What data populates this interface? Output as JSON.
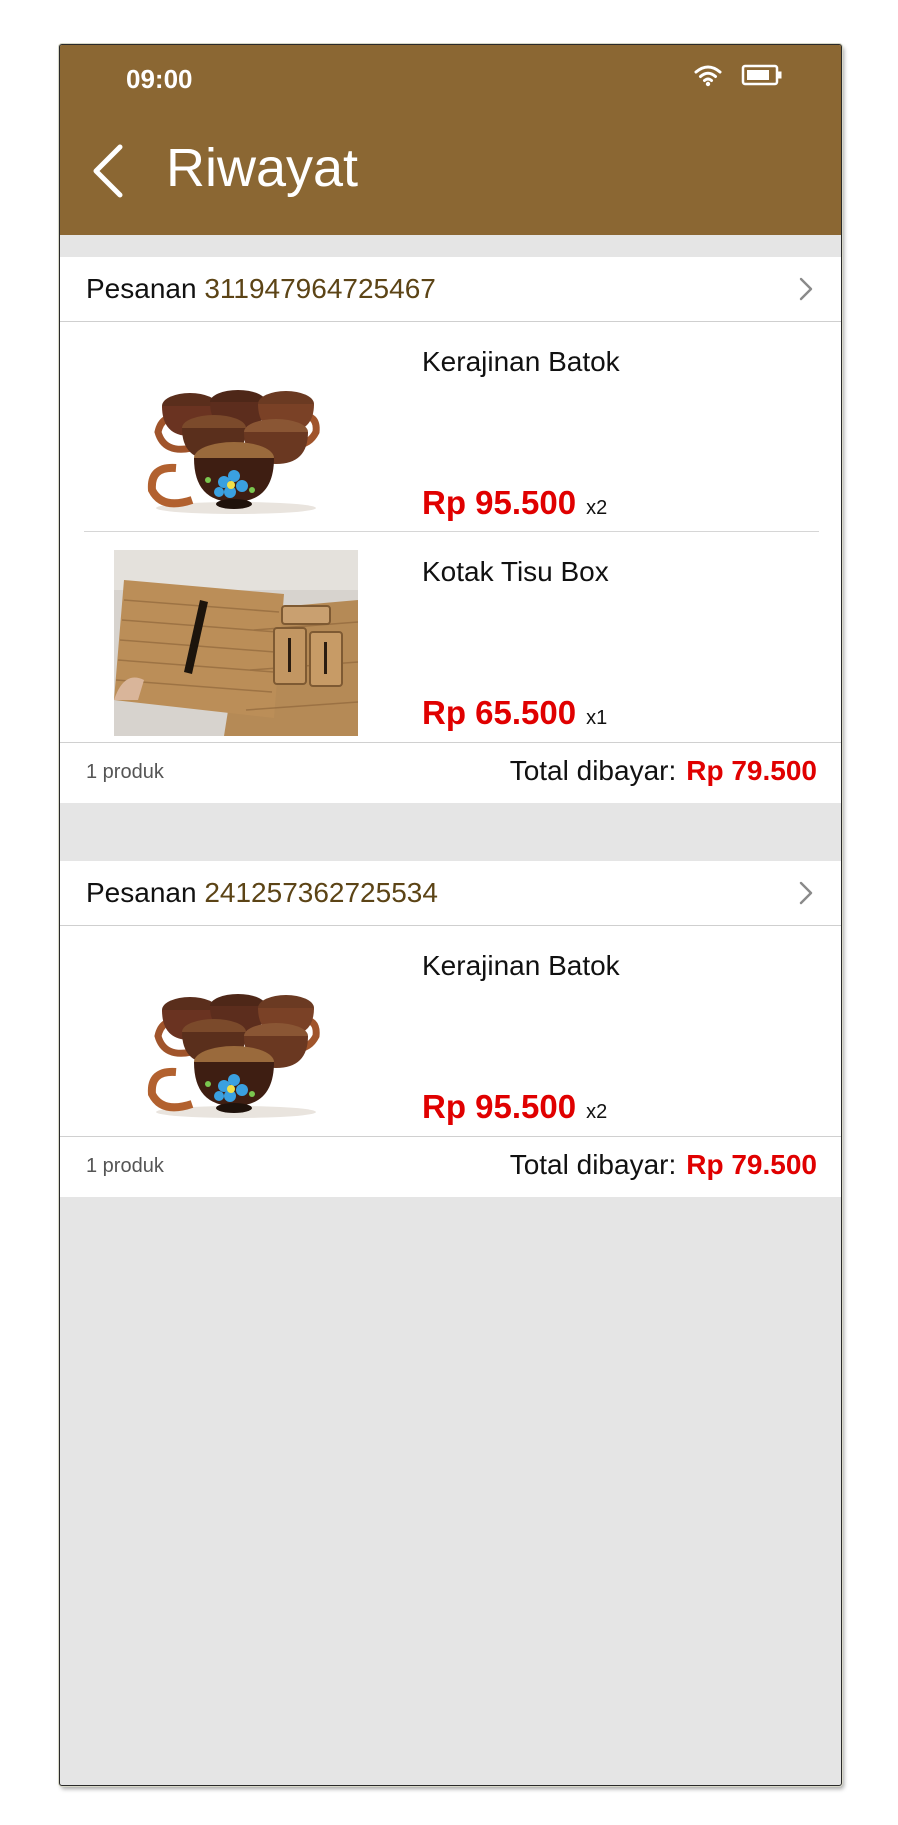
{
  "status_bar": {
    "time": "09:00",
    "icons": [
      "wifi-icon",
      "battery-icon"
    ]
  },
  "header": {
    "title": "Riwayat",
    "back_icon": "chevron-left-icon"
  },
  "colors": {
    "appbar": "#8b6733",
    "price": "#e00000",
    "order_id": "#5c4416",
    "background": "#e5e5e5"
  },
  "orders": [
    {
      "label": "Pesanan",
      "id": "311947964725467",
      "items": [
        {
          "name": "Kerajinan Batok",
          "price": "Rp 95.500",
          "qty": "x2",
          "image": "coconut-shell-cups-image"
        },
        {
          "name": "Kotak Tisu Box",
          "price": "Rp 65.500",
          "qty": "x1",
          "image": "woven-tissue-box-image"
        }
      ],
      "count_text": "1 produk",
      "total_label": "Total dibayar:",
      "total_value": "Rp 79.500"
    },
    {
      "label": "Pesanan",
      "id": "241257362725534",
      "items": [
        {
          "name": "Kerajinan Batok",
          "price": "Rp 95.500",
          "qty": "x2",
          "image": "coconut-shell-cups-image"
        }
      ],
      "count_text": "1 produk",
      "total_label": "Total dibayar:",
      "total_value": "Rp 79.500"
    }
  ]
}
